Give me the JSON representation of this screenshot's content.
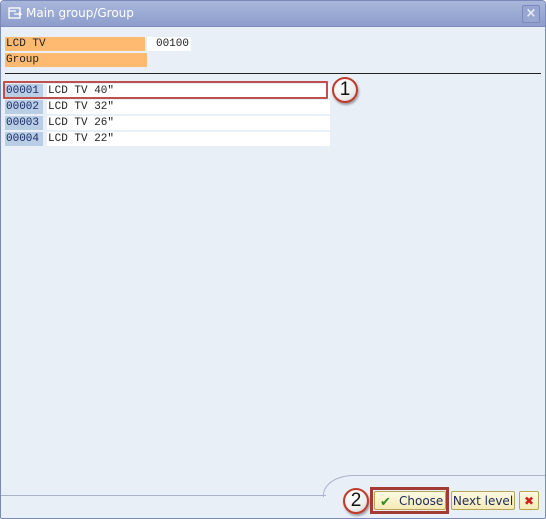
{
  "window": {
    "title": "Main group/Group",
    "title_icon": "select-dialog-icon",
    "close_icon": "close-icon"
  },
  "header": {
    "main_group_label": "LCD TV",
    "main_group_value": "00100",
    "group_label": "Group"
  },
  "rows": [
    {
      "code": "00001",
      "text": "LCD TV 40\""
    },
    {
      "code": "00002",
      "text": "LCD TV 32\""
    },
    {
      "code": "00003",
      "text": "LCD TV 26\""
    },
    {
      "code": "00004",
      "text": "LCD TV 22\""
    }
  ],
  "annotations": {
    "step1": "1",
    "step2": "2"
  },
  "buttons": {
    "choose": "Choose",
    "next_level": "Next level",
    "cancel": "✖"
  },
  "colors": {
    "label_bg": "#ffba72",
    "code_bg": "#b9cde5",
    "highlight": "#c0504d"
  }
}
